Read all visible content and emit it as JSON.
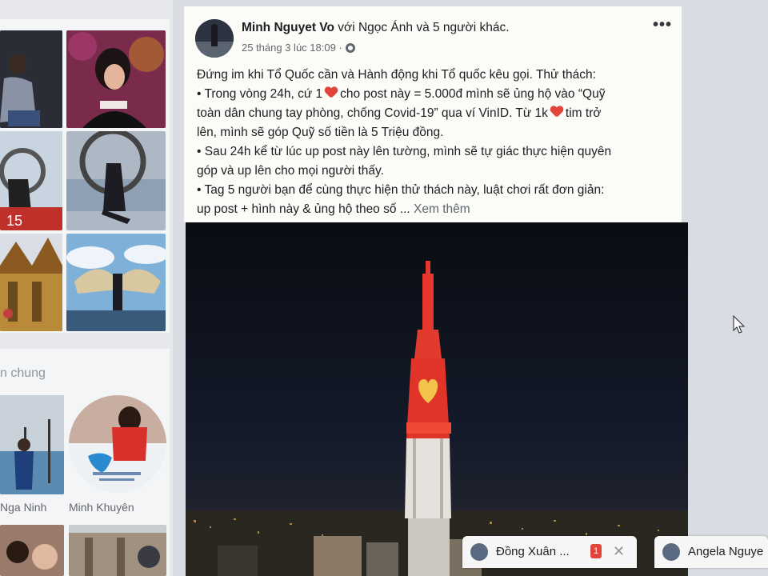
{
  "post": {
    "author": "Minh Nguyet Vo",
    "with_text": "với Ngọc Ánh và 5 người khác.",
    "timestamp": "25 tháng 3 lúc 18:09 ·",
    "privacy_icon": "globe-icon",
    "more_icon": "•••",
    "lines": {
      "l1": "Đứng im khi Tổ Quốc cần và Hành động khi Tổ quốc kêu gọi. Thử thách:",
      "l2a": "• Trong vòng 24h, cứ 1",
      "l2b": "cho post này = 5.000đ mình sẽ ủng hộ vào “Quỹ",
      "l3": "toàn dân chung tay phòng, chống Covid-19” qua ví VinID. Từ 1k",
      "l3b": "tim trở",
      "l4": "lên, mình sẽ góp Quỹ số tiền là 5 Triệu đồng.",
      "l5": "• Sau 24h kể từ lúc up post này lên tường, mình sẽ tự giác thực hiện quyên",
      "l6": "góp và up lên cho mọi người thấy.",
      "l7": "• Tag 5 người bạn để cùng thực hiện thử thách này, luật chơi rất đơn giản:",
      "l8": "up post + hình này & ủng hộ theo số ...",
      "see_more": "Xem thêm"
    }
  },
  "left": {
    "friends_title": "n chung",
    "photo_badge": "15",
    "friends": [
      {
        "name": "Nga Ninh"
      },
      {
        "name": "Minh Khuyên"
      }
    ]
  },
  "chats": [
    {
      "name": "Đồng Xuân ...",
      "badge": "1",
      "close": "✕"
    },
    {
      "name": "Angela Nguye"
    }
  ],
  "colors": {
    "accent": "#1877f2",
    "heart": "#e0443a",
    "tower": "#e8372c"
  }
}
